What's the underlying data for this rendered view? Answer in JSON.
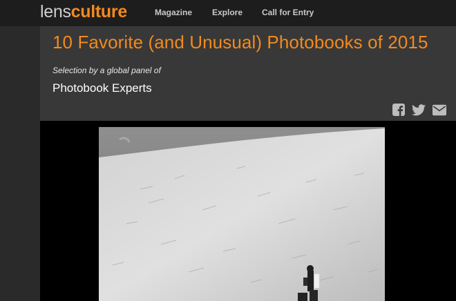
{
  "header": {
    "logo_part1": "lens",
    "logo_part2": "culture",
    "nav": [
      "Magazine",
      "Explore",
      "Call for Entry"
    ]
  },
  "article": {
    "title": "10 Favorite (and Unusual) Photobooks of 2015",
    "subtitle": "Selection by a global panel of",
    "experts": "Photobook Experts"
  },
  "share": {
    "icons": [
      "facebook-icon",
      "twitter-icon",
      "mail-icon"
    ]
  },
  "colors": {
    "accent": "#f38a1e",
    "topbar": "#1d1d1d",
    "panel": "#383838"
  }
}
